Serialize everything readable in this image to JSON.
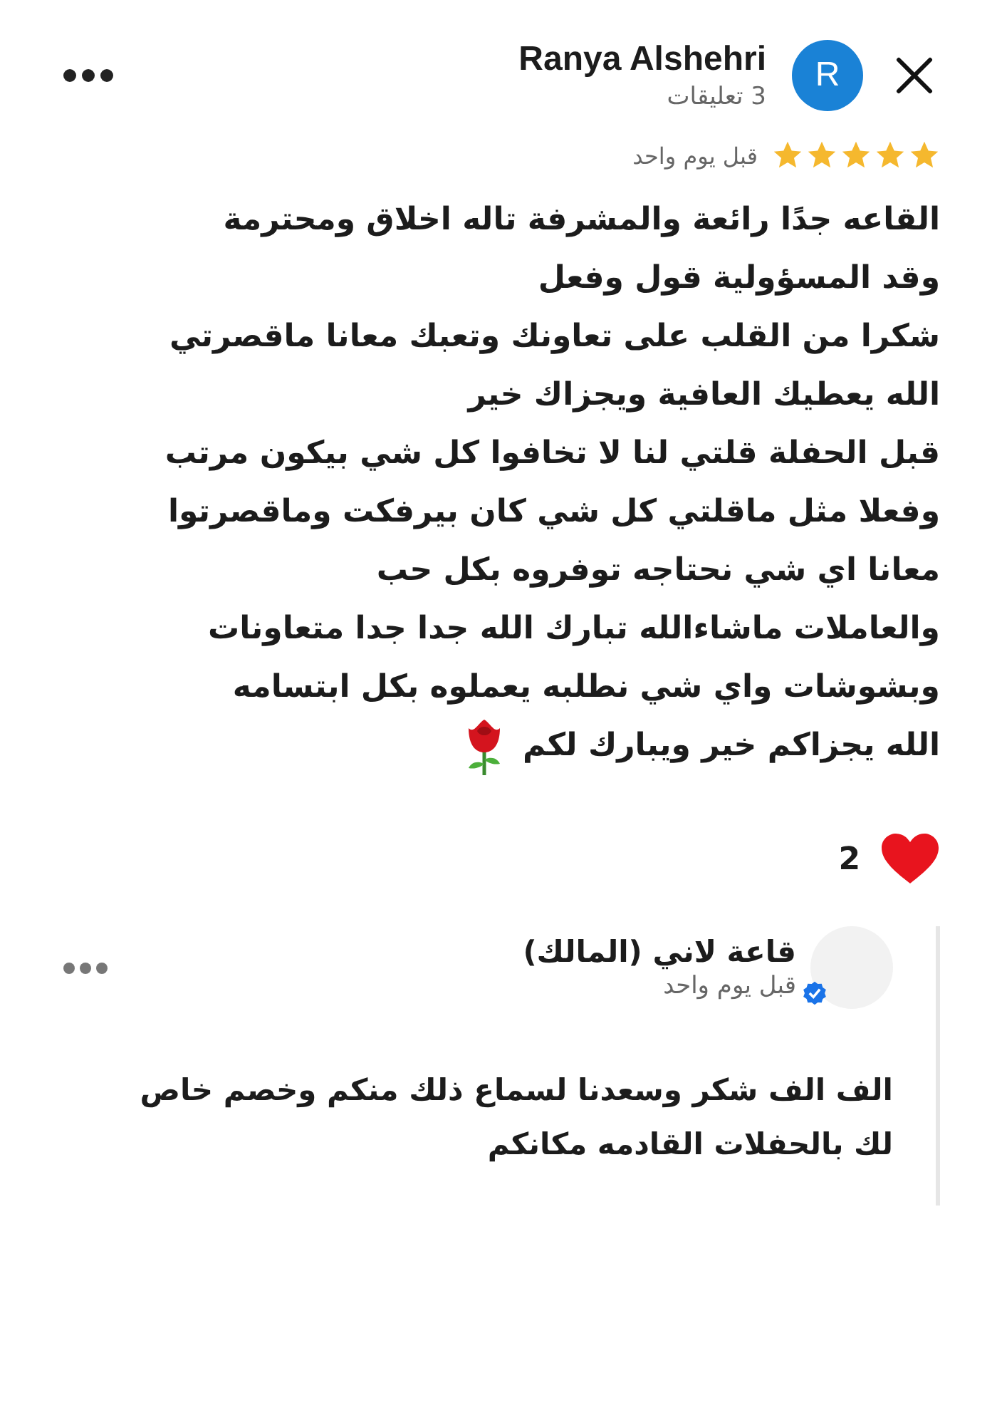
{
  "author": {
    "name": "Ranya Alshehri",
    "initial": "R",
    "comment_count": "3 تعليقات"
  },
  "review": {
    "stars": 5,
    "time": "قبل يوم واحد",
    "lines": [
      "القاعه جدًا رائعة والمشرفة تاله اخلاق ومحترمة",
      "وقد المسؤولية قول وفعل",
      "شكرا من القلب على تعاونك وتعبك معانا ماقصرتي",
      "الله يعطيك العافية ويجزاك خير",
      "قبل الحفلة قلتي لنا لا تخافوا كل شي بيكون مرتب",
      "وفعلا مثل ماقلتي كل شي كان بيرفكت وماقصرتوا",
      "معانا اي شي نحتاجه توفروه بكل حب",
      "والعاملات ماشاءالله تبارك الله جدا جدا متعاونات",
      "وبشوشات واي شي نطلبه يعملوه بكل ابتسامه",
      "الله يجزاكم خير ويبارك لكم"
    ]
  },
  "reactions": {
    "count": "2"
  },
  "reply": {
    "name": "قاعة لاني (المالك)",
    "verified": true,
    "time": "قبل يوم واحد",
    "text": "الف الف شكر وسعدنا لسماع ذلك منكم وخصم خاص\nلك بالحفلات القادمه مكانكم"
  }
}
